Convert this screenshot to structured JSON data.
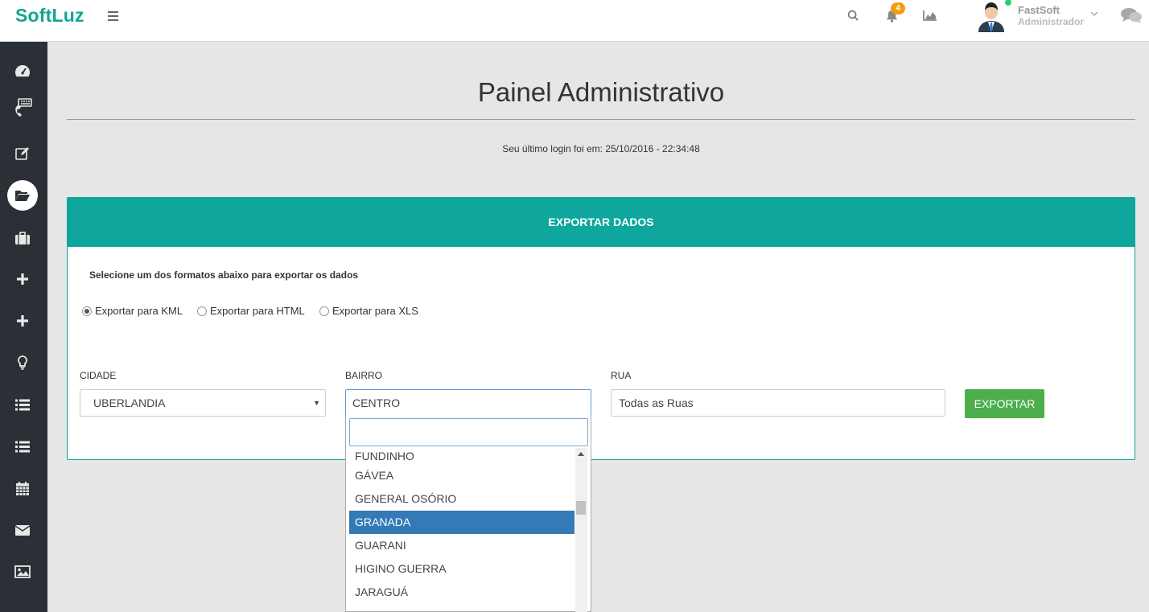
{
  "brand": "SoftLuz",
  "header": {
    "notification_count": "4",
    "user": {
      "name": "FastSoft",
      "role": "Administrador"
    }
  },
  "sidebar": {
    "items": [
      {
        "icon": "dashboard-icon"
      },
      {
        "icon": "phone-keyboard-icon"
      },
      {
        "icon": "edit-icon"
      },
      {
        "icon": "folder-open-icon",
        "active": true
      },
      {
        "icon": "briefcase-icon"
      },
      {
        "icon": "plus-icon"
      },
      {
        "icon": "plus-icon"
      },
      {
        "icon": "lightbulb-icon"
      },
      {
        "icon": "list-icon"
      },
      {
        "icon": "list-icon"
      },
      {
        "icon": "calendar-icon"
      },
      {
        "icon": "envelope-icon"
      },
      {
        "icon": "image-icon"
      }
    ]
  },
  "main": {
    "title": "Painel Administrativo",
    "last_login": "Seu último login foi em: 25/10/2016 - 22:34:48"
  },
  "panel": {
    "heading": "EXPORTAR DADOS",
    "instruction": "Selecione um dos formatos abaixo para exportar os dados",
    "formats": [
      {
        "label": "Exportar para KML",
        "checked": true
      },
      {
        "label": "Exportar para HTML",
        "checked": false
      },
      {
        "label": "Exportar para XLS",
        "checked": false
      }
    ],
    "cidade": {
      "label": "CIDADE",
      "value": "UBERLANDIA"
    },
    "bairro": {
      "label": "BAIRRO",
      "value": "CENTRO"
    },
    "rua": {
      "label": "RUA",
      "value": "Todas as Ruas"
    },
    "export_button": "EXPORTAR"
  },
  "dropdown": {
    "search_value": "",
    "options": [
      "FUNDINHO",
      "GÁVEA",
      "GENERAL OSÓRIO",
      "GRANADA",
      "GUARANI",
      "HIGINO GUERRA",
      "JARAGUÁ"
    ],
    "highlighted": "GRANADA"
  },
  "colors": {
    "brand": "#12a594",
    "panel_header": "#0fa79d",
    "sidebar": "#2b3036",
    "export_button": "#4cae4c",
    "highlight": "#337ab7",
    "badge": "#f39c12"
  }
}
